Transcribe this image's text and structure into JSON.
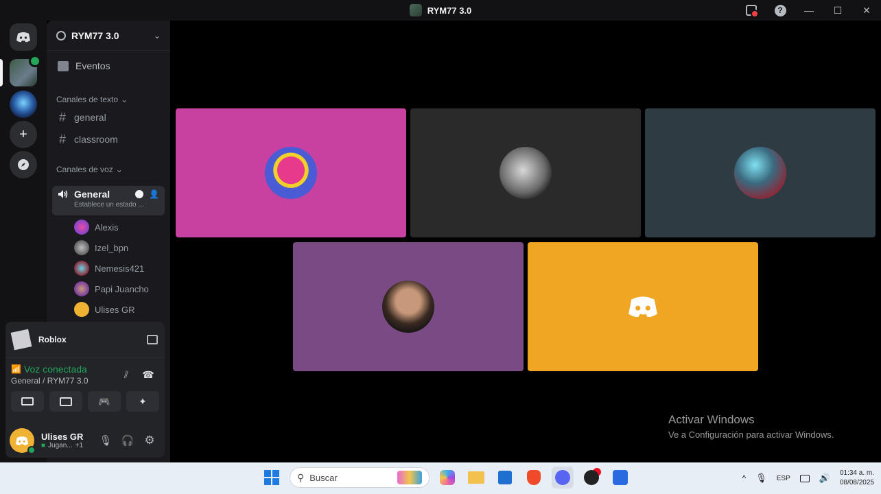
{
  "window": {
    "title": "RYM77 3.0"
  },
  "server": {
    "name": "RYM77 3.0"
  },
  "sidebar": {
    "events_label": "Eventos",
    "text_category": "Canales de texto",
    "text_channels": [
      "general",
      "classroom"
    ],
    "voice_category": "Canales de voz",
    "voice_channel": {
      "name": "General",
      "status": "Establece un estado ..."
    },
    "voice_users": [
      "Alexis",
      "Izel_bpn",
      "Nemesis421",
      "Papi Juancho",
      "Ulises GR"
    ]
  },
  "panel": {
    "activity": "Roblox",
    "voice_connected": "Voz conectada",
    "voice_location": "General / RYM77 3.0",
    "user": {
      "name": "Ulises GR",
      "status": "Jugan...",
      "extra": "+1"
    }
  },
  "watermark": {
    "title": "Activar Windows",
    "subtitle": "Ve a Configuración para activar Windows."
  },
  "taskbar": {
    "search_placeholder": "Buscar",
    "lang": "ESP",
    "time": "01:34 a. m.",
    "date": "08/08/2025"
  },
  "colors": {
    "tile1": "#c840a0",
    "tile2": "#2a2a2a",
    "tile3": "#2f3b42",
    "tile4": "#7a4a85",
    "tile5": "#f0a623",
    "voice_green": "#23a55a"
  }
}
